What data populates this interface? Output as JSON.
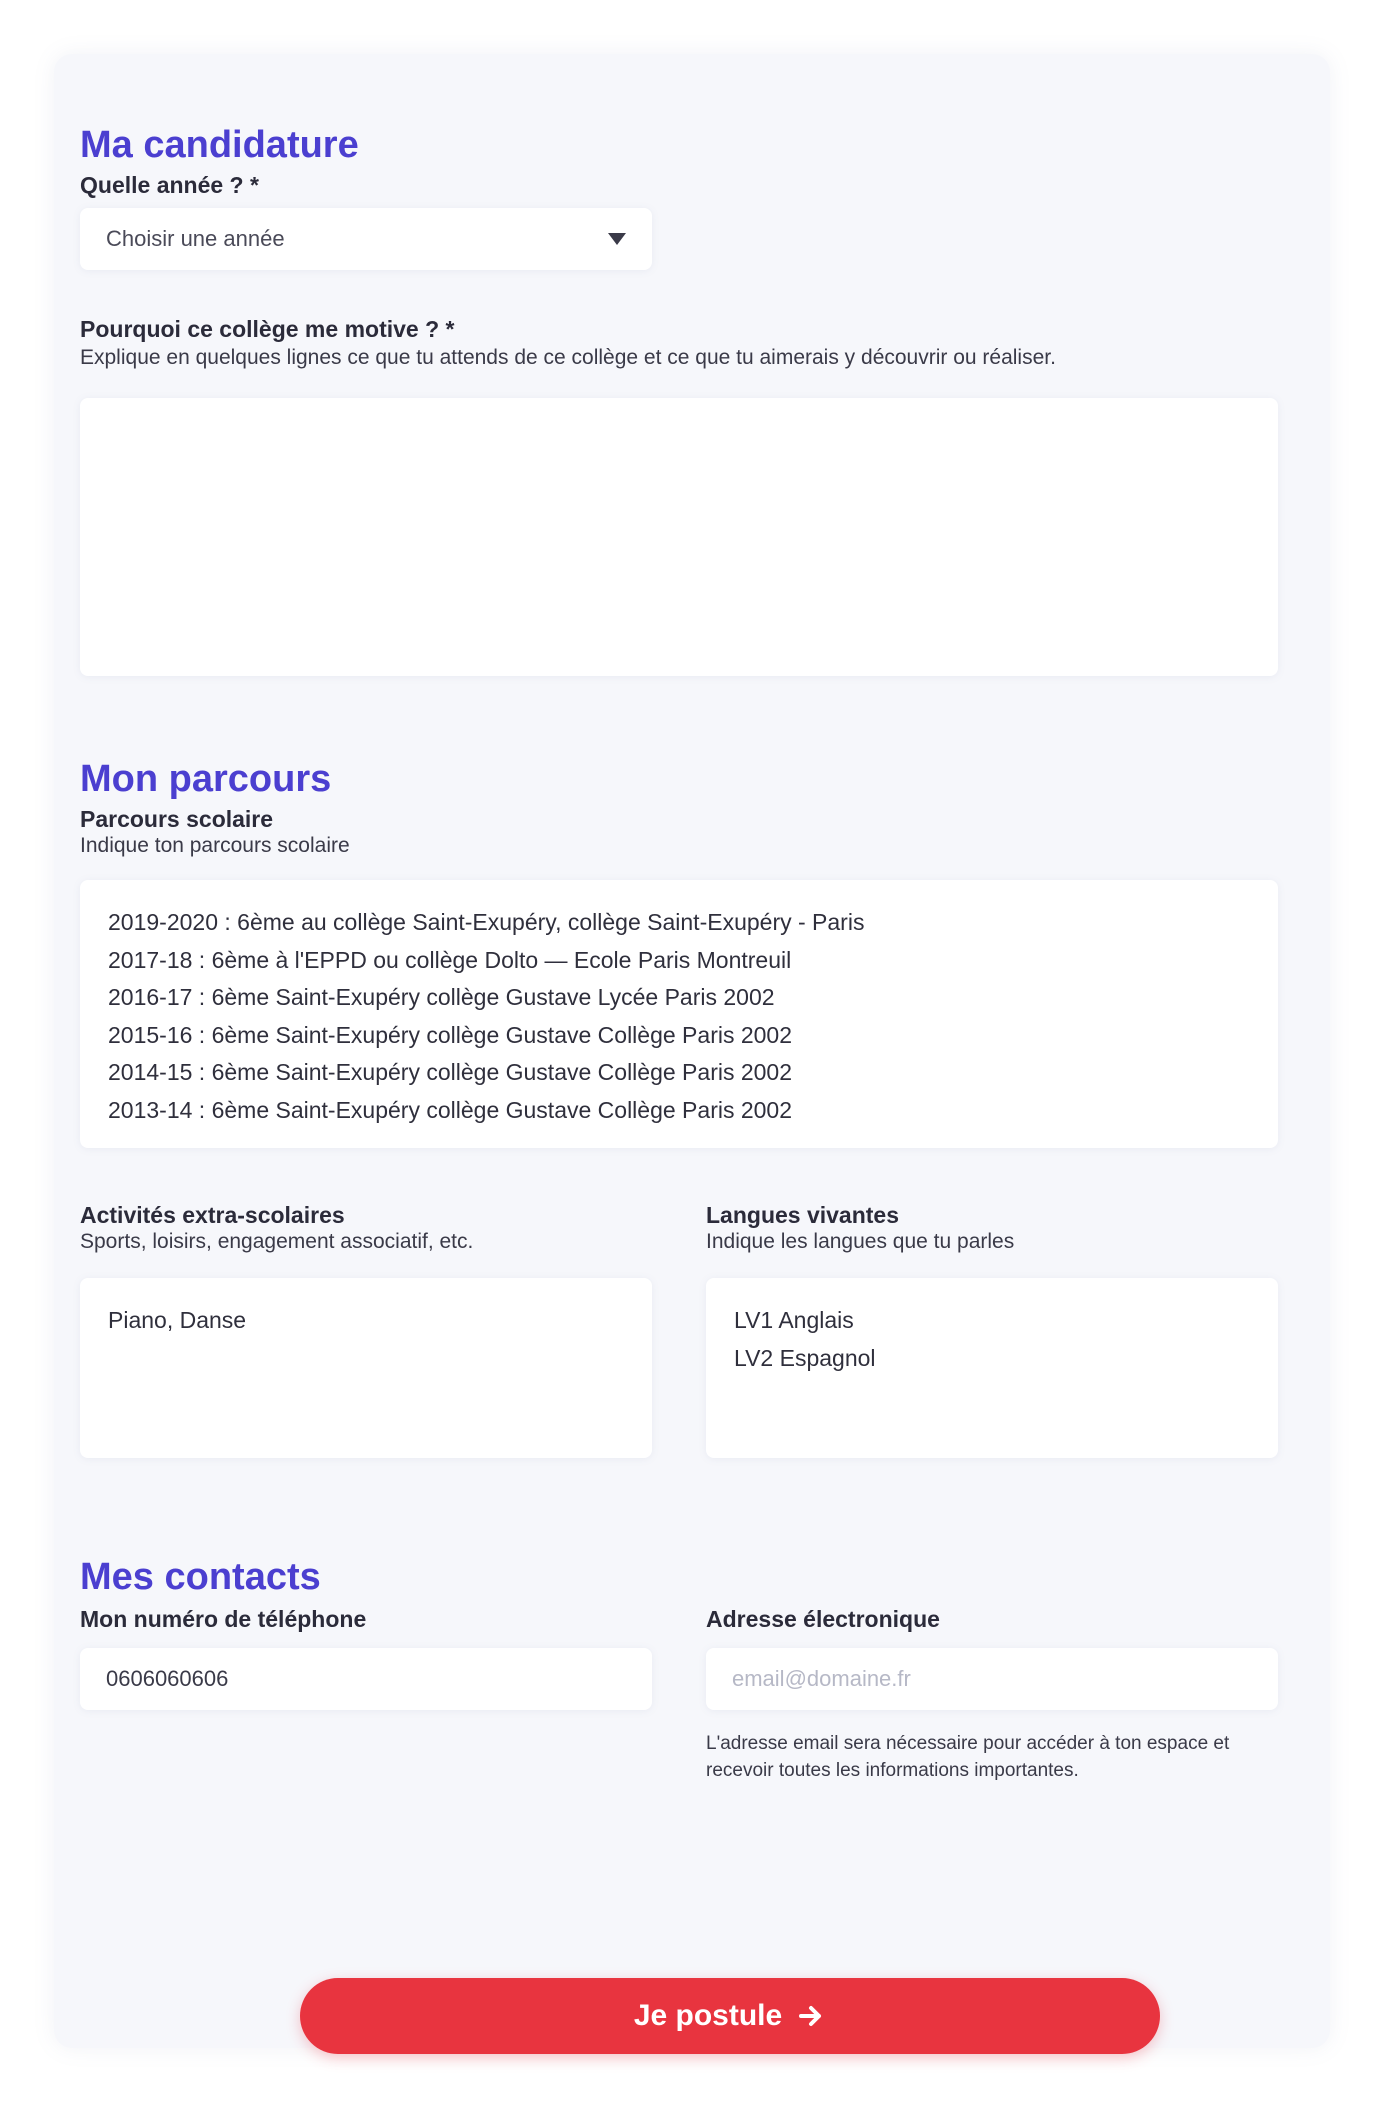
{
  "candidature": {
    "title": "Ma candidature",
    "filiere_label": "Quelle année ? *",
    "filiere_value": "Choisir une année",
    "motivation_label": "Pourquoi ce collège me motive ? *",
    "motivation_hint": "Explique en quelques lignes ce que tu attends de ce collège et ce que tu aimerais y découvrir ou réaliser.",
    "motivation_value": ""
  },
  "parcours": {
    "title": "Mon parcours",
    "scolarite_label": "Parcours scolaire",
    "scolarite_hint": "Indique ton parcours scolaire",
    "scolarite_lines": [
      "2019-2020 : 6ème au collège Saint-Exupéry, collège Saint-Exupéry - Paris",
      "2017-18 : 6ème à l'EPPD ou collège Dolto — Ecole Paris Montreuil",
      "2016-17 : 6ème Saint-Exupéry collège Gustave Lycée Paris 2002",
      "2015-16 : 6ème Saint-Exupéry collège Gustave Collège Paris 2002",
      "2014-15 : 6ème Saint-Exupéry collège Gustave Collège Paris 2002",
      "2013-14 : 6ème Saint-Exupéry collège Gustave Collège Paris 2002"
    ],
    "activites_label": "Activités extra-scolaires",
    "activites_hint": "Sports, loisirs, engagement associatif, etc.",
    "activites_lines": [
      "Piano, Danse"
    ],
    "langues_label": "Langues vivantes",
    "langues_hint": "Indique les langues que tu parles",
    "langues_lines": [
      "LV1 Anglais",
      "LV2 Espagnol"
    ]
  },
  "contacts": {
    "title": "Mes contacts",
    "phone_label": "Mon numéro de téléphone",
    "phone_value": "0606060606",
    "email_label": "Adresse électronique",
    "email_placeholder": "email@domaine.fr",
    "email_note": "L'adresse email sera nécessaire pour accéder à ton espace et recevoir toutes les informations importantes."
  },
  "submit_label": "Je postule",
  "colors": {
    "accent": "#4b3fd0",
    "submit": "#e8343f",
    "card": "#f6f7fb"
  }
}
